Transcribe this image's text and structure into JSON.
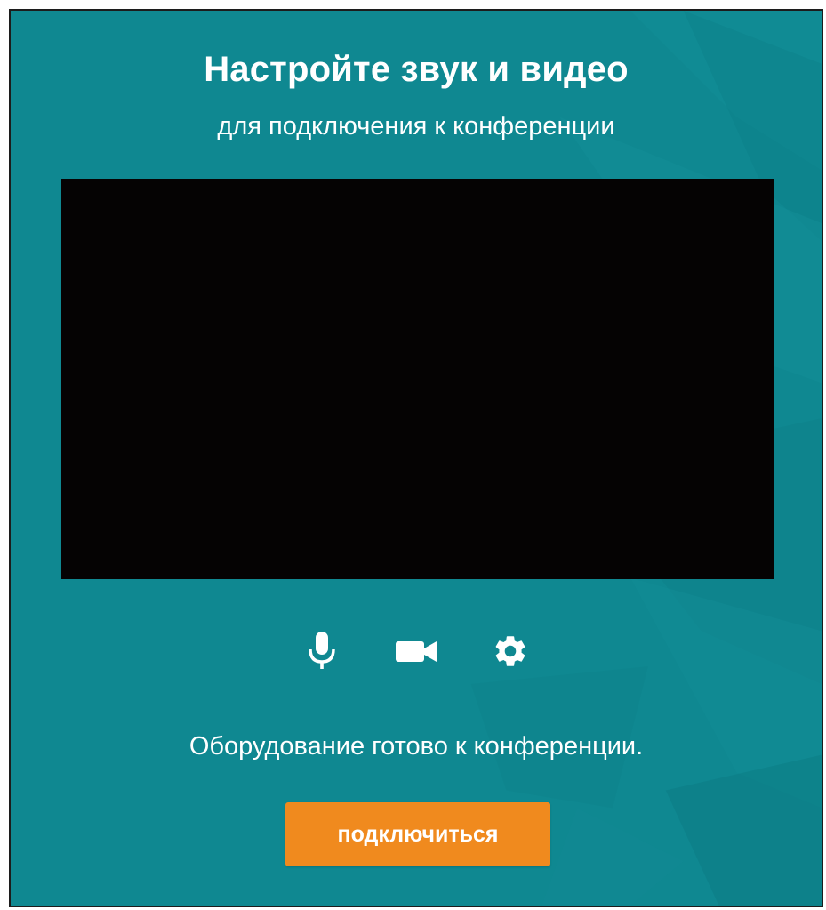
{
  "header": {
    "title": "Настройте звук и видео",
    "subtitle": "для подключения к конференции"
  },
  "controls": {
    "microphone_icon": "microphone-icon",
    "camera_icon": "video-camera-icon",
    "settings_icon": "gear-icon"
  },
  "status": {
    "message": "Оборудование готово к конференции."
  },
  "join_button": {
    "label": "подключиться"
  },
  "colors": {
    "panel_background": "#0f8891",
    "video_background": "#050303",
    "button_background": "#f08a1e",
    "text": "#ffffff"
  }
}
